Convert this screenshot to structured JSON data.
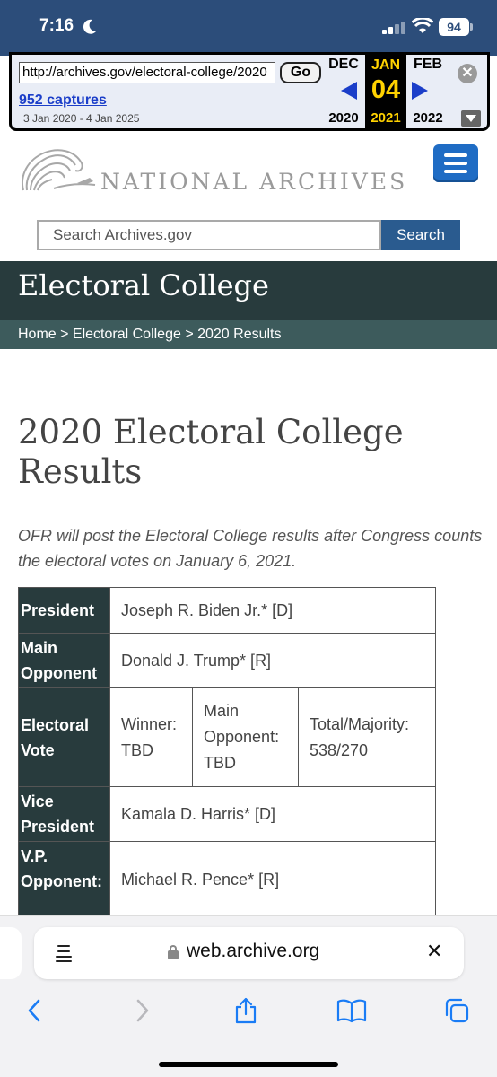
{
  "status_bar": {
    "time": "7:16",
    "battery": "94"
  },
  "wayback": {
    "url": "http://archives.gov/electoral-college/2020",
    "go_label": "Go",
    "captures": "952 captures",
    "range": "3 Jan 2020 - 4 Jan 2025",
    "prev_month": "DEC",
    "prev_year": "2020",
    "cur_month": "JAN",
    "cur_day": "04",
    "cur_year": "2021",
    "next_month": "FEB",
    "next_year": "2022",
    "close_glyph": "✕"
  },
  "site": {
    "logo_text": "NATIONAL ARCHIVES",
    "search_placeholder": "Search Archives.gov",
    "search_button": "Search",
    "section_title": "Electoral College",
    "breadcrumb": "Home > Electoral College > 2020 Results"
  },
  "page": {
    "title": "2020 Electoral College Results",
    "note": "OFR will post the Electoral College results after Congress counts the electoral votes on January 6, 2021."
  },
  "table": {
    "president_label": "President",
    "president_value": "Joseph R. Biden Jr.* [D]",
    "opponent_label": "Main Opponent",
    "opponent_value": "Donald J. Trump* [R]",
    "ev_label": "Electoral Vote",
    "ev_winner": "Winner: TBD",
    "ev_opponent": "Main Opponent: TBD",
    "ev_total": "Total/Majority: 538/270",
    "vp_label": "Vice President",
    "vp_value": "Kamala D. Harris* [D]",
    "vpo_label": "V.P. Opponent:",
    "vpo_value": "Michael R. Pence* [R]"
  },
  "safari": {
    "address": "web.archive.org",
    "clear_glyph": "✕"
  },
  "colors": {
    "header_band": "#283b3d",
    "breadcrumb_band": "#3d5b5c",
    "search_button": "#2a5b8f",
    "ios_blue": "#1a7cf5"
  }
}
